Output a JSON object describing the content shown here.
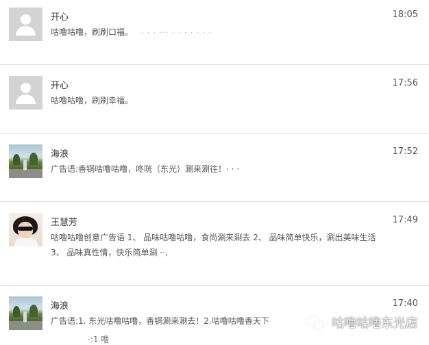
{
  "items": [
    {
      "name": "开心",
      "time": "18:05",
      "message": "咕噜咕噜，刷刷口福。",
      "noise": "· · · ··· · · · · · · ·"
    },
    {
      "name": "开心",
      "time": "17:56",
      "message": "咕噜咕噜，刷刷幸福。"
    },
    {
      "name": "海浪",
      "time": "17:52",
      "message": "广告语:香锅咕噜咕噜，咚咣（东光）涮来涮往！· · ·"
    },
    {
      "name": "王慧芳",
      "time": "17:49",
      "message": "咕噜咕噜创意广告语 1、 品味咕噜咕噜，食尚涮来涮去 2、 品味简单快乐，涮出美味生活 3、 品味真性情，快乐简单涮 ··,"
    },
    {
      "name": "海浪",
      "time": "17:40",
      "message": "广告语:1. 东光咕噜咕噜，香锅涮来涮去！2.咕噜咕噜香天下"
    }
  ],
  "tail_text": "·:1            噜",
  "watermark": "咕噜咕噜东光店"
}
